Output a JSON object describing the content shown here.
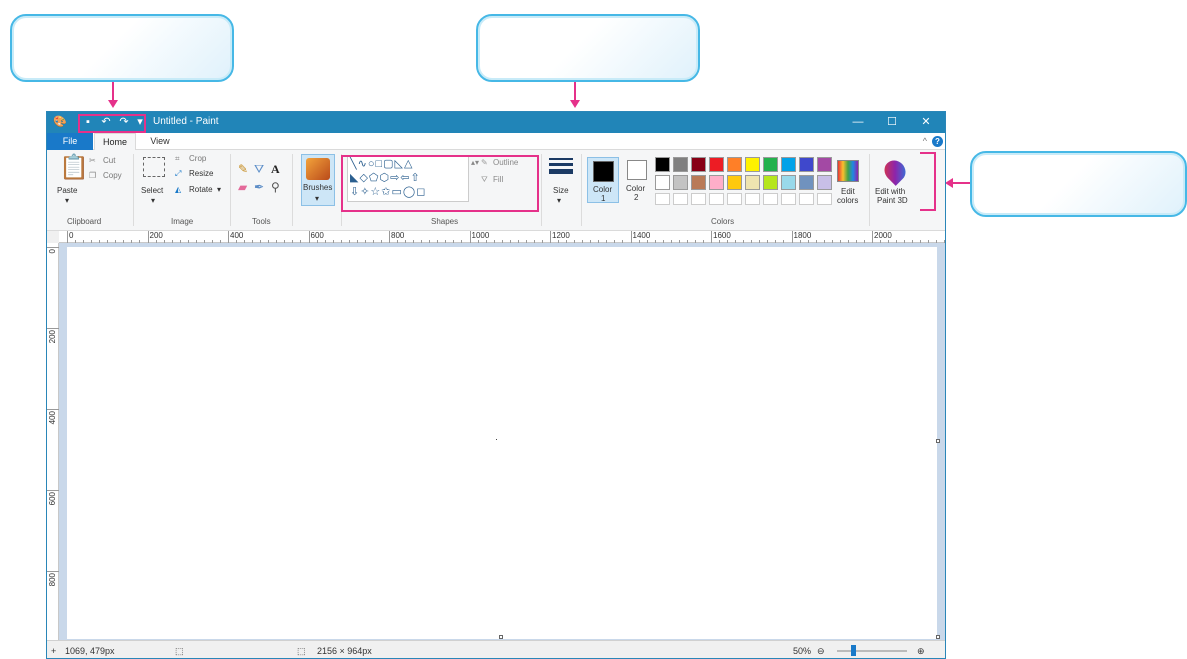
{
  "window": {
    "title": "Untitled - Paint",
    "controls": {
      "minimize": "—",
      "maximize": "☐",
      "close": "✕"
    }
  },
  "quick_access": {
    "save_icon": "save-icon",
    "undo_icon": "undo-icon",
    "redo_icon": "redo-icon",
    "customize": "▾"
  },
  "tabs": {
    "file": "File",
    "home": "Home",
    "view": "View"
  },
  "help": "?",
  "ribbon": {
    "clipboard": {
      "paste": "Paste",
      "cut": "Cut",
      "copy": "Copy",
      "group": "Clipboard"
    },
    "image": {
      "select": "Select",
      "crop": "Crop",
      "resize": "Resize",
      "rotate": "Rotate",
      "group": "Image"
    },
    "tools": {
      "group": "Tools",
      "text_tool": "A"
    },
    "brushes": {
      "label": "Brushes"
    },
    "shapes": {
      "outline": "Outline",
      "fill": "Fill",
      "group": "Shapes"
    },
    "size": {
      "label": "Size"
    },
    "colors": {
      "color1": "Color",
      "color1_num": "1",
      "color2": "Color",
      "color2_num": "2",
      "edit": "Edit",
      "edit2": "colors",
      "group": "Colors",
      "palette_row1": [
        "#000000",
        "#7f7f7f",
        "#880015",
        "#ed1c24",
        "#ff7f27",
        "#fff200",
        "#22b14c",
        "#00a2e8",
        "#3f48cc",
        "#a349a4"
      ],
      "palette_row2": [
        "#ffffff",
        "#c3c3c3",
        "#b97a57",
        "#ffaec9",
        "#ffc90e",
        "#efe4b0",
        "#b5e61d",
        "#99d9ea",
        "#7092be",
        "#c8bfe7"
      ]
    },
    "paint3d": {
      "line1": "Edit with",
      "line2": "Paint 3D"
    }
  },
  "ruler": {
    "horizontal": [
      "0",
      "200",
      "400",
      "600",
      "800",
      "1000",
      "1200",
      "1400",
      "1600",
      "1800",
      "2000"
    ],
    "vertical": [
      "0",
      "200",
      "400",
      "600",
      "800"
    ]
  },
  "status": {
    "cursor_pos": "1069, 479px",
    "canvas_size": "2156 × 964px",
    "zoom": "50%"
  }
}
